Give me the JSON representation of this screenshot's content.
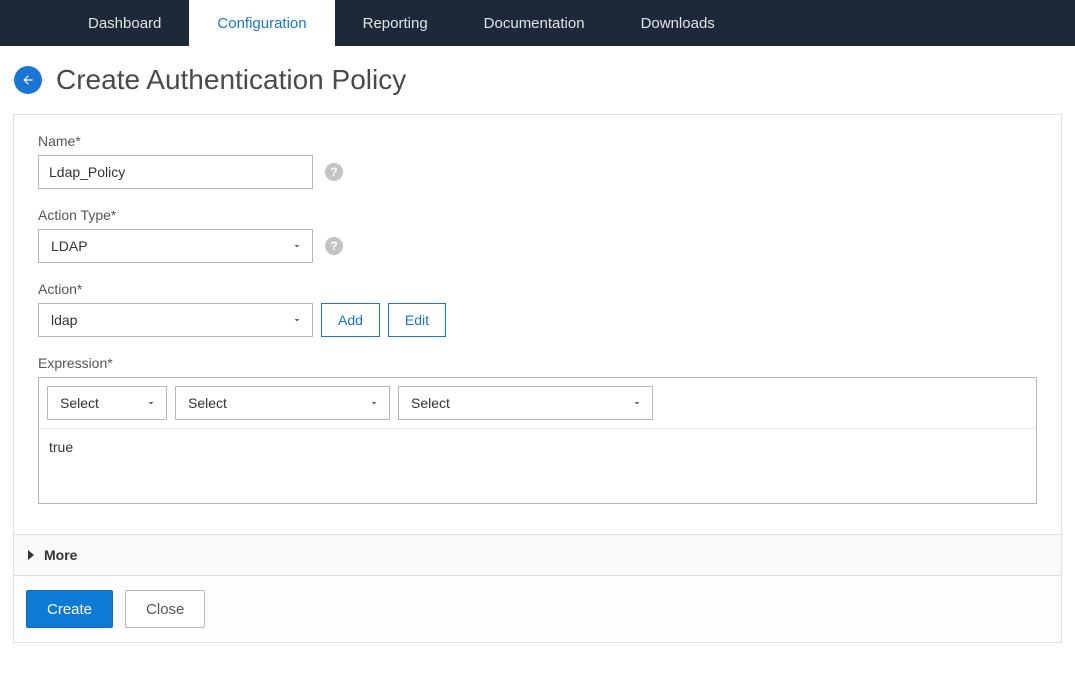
{
  "nav": {
    "items": [
      {
        "label": "Dashboard",
        "active": false
      },
      {
        "label": "Configuration",
        "active": true
      },
      {
        "label": "Reporting",
        "active": false
      },
      {
        "label": "Documentation",
        "active": false
      },
      {
        "label": "Downloads",
        "active": false
      }
    ]
  },
  "page": {
    "title": "Create Authentication Policy"
  },
  "form": {
    "name": {
      "label": "Name*",
      "value": "Ldap_Policy"
    },
    "actionType": {
      "label": "Action Type*",
      "value": "LDAP"
    },
    "action": {
      "label": "Action*",
      "value": "ldap",
      "addLabel": "Add",
      "editLabel": "Edit"
    },
    "expression": {
      "label": "Expression*",
      "select1": "Select",
      "select2": "Select",
      "select3": "Select",
      "value": "true"
    }
  },
  "more": {
    "label": "More"
  },
  "footer": {
    "create": "Create",
    "close": "Close"
  }
}
